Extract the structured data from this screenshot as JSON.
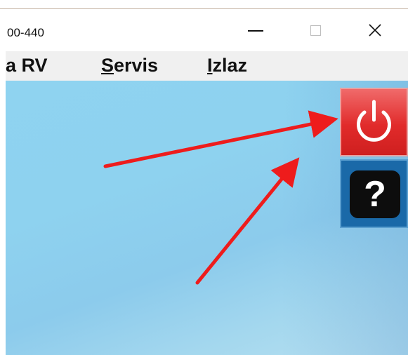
{
  "window": {
    "title": "00-440"
  },
  "controls": {
    "minimize_icon": "minimize-icon",
    "maximize_icon": "maximize-icon",
    "close_glyph": "✕"
  },
  "menu": {
    "items": [
      {
        "prefix": "a RV",
        "mnemonic": "",
        "rest": ""
      },
      {
        "prefix": "",
        "mnemonic": "S",
        "rest": "ervis"
      },
      {
        "prefix": "",
        "mnemonic": "I",
        "rest": "zlaz"
      }
    ]
  },
  "tools": {
    "power_icon": "power-icon",
    "help_glyph": "?",
    "power_color": "#e12b2b",
    "help_color": "#1a69a8"
  },
  "annotations": {
    "arrow_color": "#ee1c1c"
  }
}
